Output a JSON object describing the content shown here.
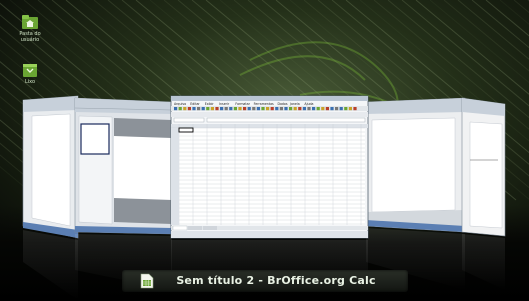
{
  "desktop": {
    "icons": [
      {
        "label": "Pasta do usuário"
      },
      {
        "label": "Lixo"
      }
    ]
  },
  "switcher": {
    "active_window_title": "Sem título 2 - BrOffice.org Calc"
  },
  "windows": [
    {
      "app": "writer"
    },
    {
      "app": "impress"
    },
    {
      "app": "calc",
      "menu": [
        "Arquivo",
        "Editar",
        "Exibir",
        "Inserir",
        "Formatar",
        "Ferramentas",
        "Dados",
        "Janela",
        "Ajuda"
      ],
      "sheet_tabs": [
        "Planilha1",
        "Planilha2",
        "Planilha3"
      ]
    },
    {
      "app": "writer"
    },
    {
      "app": "writer"
    }
  ],
  "colors": {
    "accent": "#7db84a",
    "wallpaper": "#1c2a14"
  }
}
